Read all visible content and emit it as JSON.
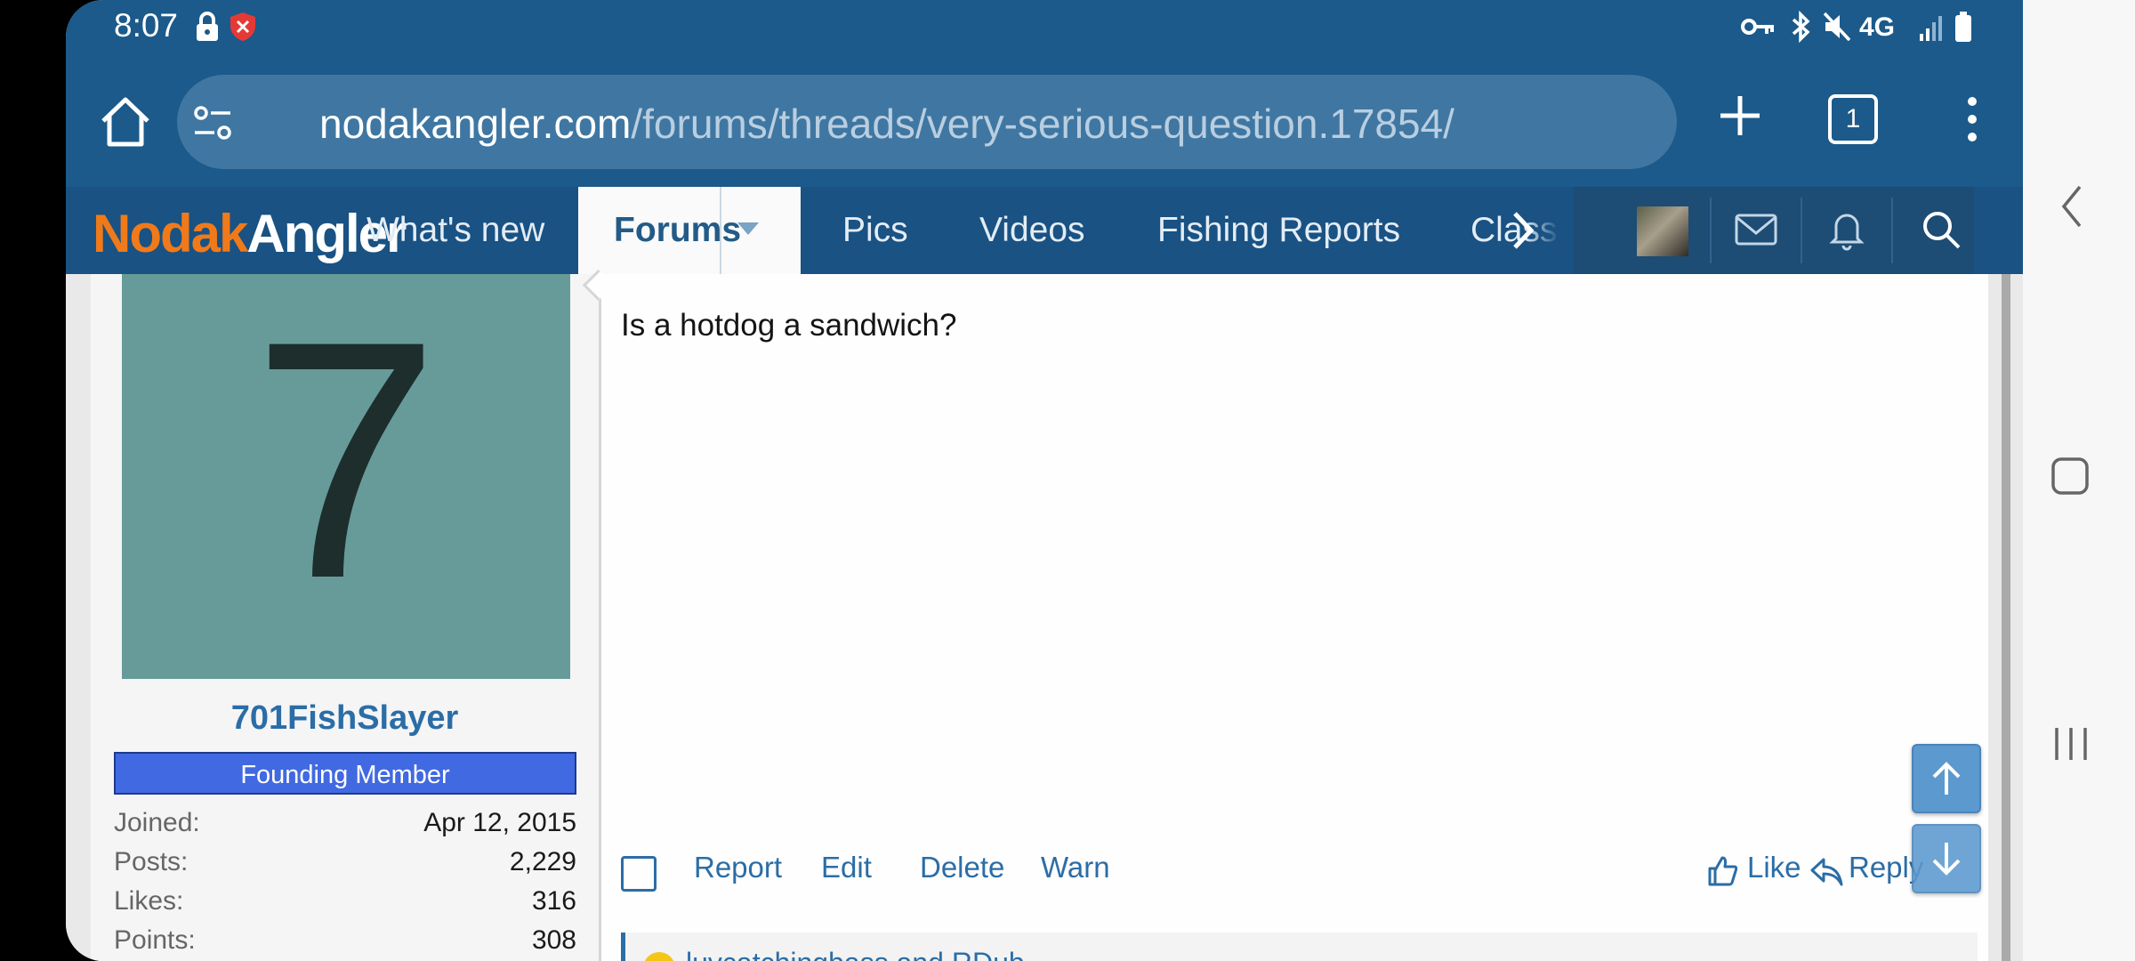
{
  "status_bar": {
    "time": "8:07",
    "network": "4G",
    "icons_left": [
      "lock-icon",
      "shield-alert-icon"
    ],
    "icons_right": [
      "vpn-key-icon",
      "bluetooth-icon",
      "mute-icon",
      "network-4g-icon",
      "signal-icon",
      "battery-icon"
    ]
  },
  "browser": {
    "url_domain": "nodakangler.com",
    "url_path": "/forums/threads/very-serious-question.17854/",
    "tab_count": "1"
  },
  "forum_nav": {
    "logo_part1": "Nodak",
    "logo_part2": "Angler",
    "tabs": [
      "What's new",
      "Forums",
      "Pics",
      "Videos",
      "Fishing Reports",
      "Class"
    ]
  },
  "user": {
    "avatar_letter": "7",
    "name": "701FishSlayer",
    "title": "Founding Member",
    "stats": [
      {
        "label": "Joined:",
        "value": "Apr 12, 2015"
      },
      {
        "label": "Posts:",
        "value": "2,229"
      },
      {
        "label": "Likes:",
        "value": "316"
      },
      {
        "label": "Points:",
        "value": "308"
      }
    ]
  },
  "post": {
    "body": "Is a hotdog a sandwich?",
    "actions": [
      "Report",
      "Edit",
      "Delete",
      "Warn"
    ],
    "like_label": "Like",
    "reply_label": "Reply",
    "reactions_text": "luvcatchingbass and RDub"
  },
  "colors": {
    "header_blue": "#1b5a8a",
    "nav_blue": "#195283",
    "link_blue": "#2b6da6",
    "avatar_teal": "#679b99",
    "badge_blue": "#4169e1",
    "logo_orange": "#f07a1a"
  }
}
